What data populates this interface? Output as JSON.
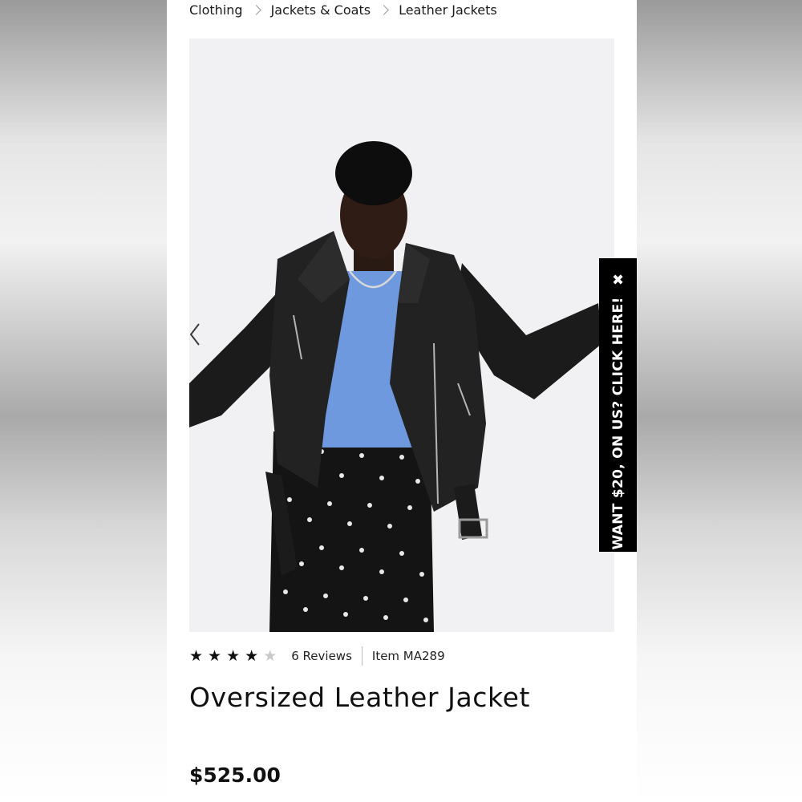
{
  "breadcrumb": {
    "items": [
      "Clothing",
      "Jackets & Coats",
      "Leather Jackets"
    ]
  },
  "product": {
    "rating": 4,
    "rating_max": 5,
    "reviews_label": "6 Reviews",
    "item_number": "Item MA289",
    "title": "Oversized Leather Jacket",
    "price": "$525.00"
  },
  "promo": {
    "text": "WANT $20, ON US? CLICK HERE!",
    "close_glyph": "✖"
  },
  "icons": {
    "prev": "chevron-left-icon",
    "star": "star-icon",
    "close": "close-icon"
  },
  "colors": {
    "text": "#111111",
    "star_empty": "#c9c9c9",
    "promo_bg": "#000000",
    "image_bg": "#f1f1f3"
  }
}
